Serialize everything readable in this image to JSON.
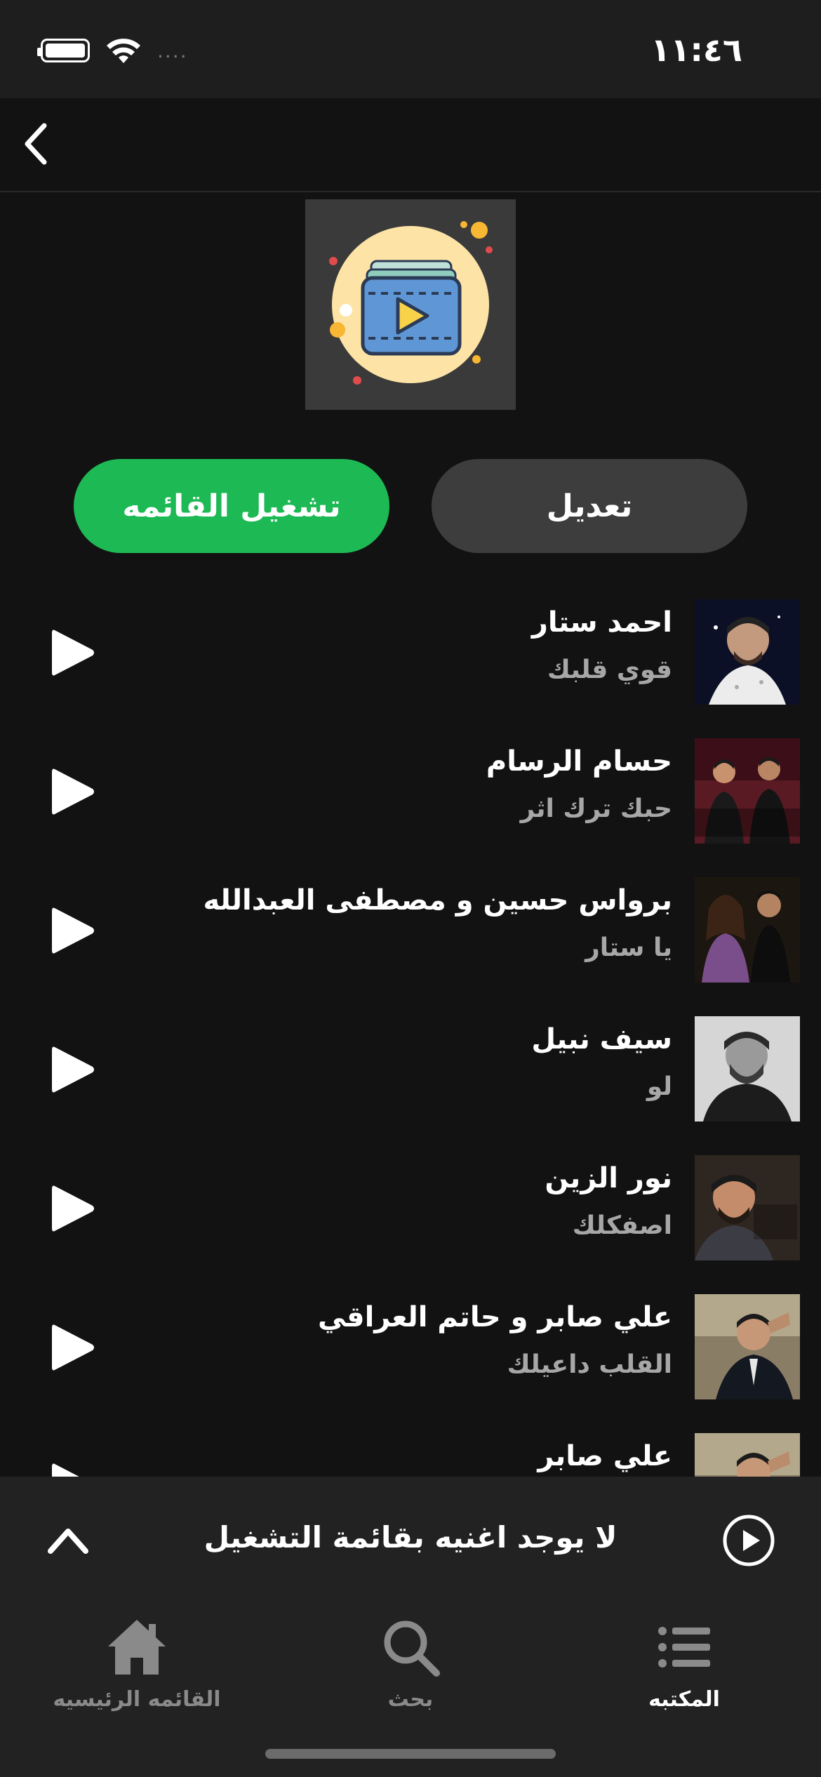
{
  "status": {
    "time": "١١:٤٦",
    "signal": "...."
  },
  "header": {
    "back_icon": "chevron-left-icon"
  },
  "playlist": {
    "cover_icon": "video-playlist-icon",
    "play_all_label": "تشغيل القائمه",
    "edit_label": "تعديل"
  },
  "tracks": [
    {
      "artist": "احمد ستار",
      "song": "قوي قلبك"
    },
    {
      "artist": "حسام الرسام",
      "song": "حبك ترك اثر"
    },
    {
      "artist": "برواس حسين و مصطفى العبدالله",
      "song": "يا ستار"
    },
    {
      "artist": "سيف نبيل",
      "song": "لو"
    },
    {
      "artist": "نور الزين",
      "song": "اصفكلك"
    },
    {
      "artist": "علي صابر و حاتم العراقي",
      "song": "القلب داعيلك"
    },
    {
      "artist": "علي صابر",
      "song": ""
    }
  ],
  "mini_player": {
    "text": "لا يوجد اغنيه بقائمة التشغيل"
  },
  "tabs": {
    "home": "القائمه الرئيسيه",
    "search": "بحث",
    "library": "المكتبه"
  },
  "colors": {
    "accent": "#1db954",
    "background": "#121212",
    "surface": "#222222"
  }
}
